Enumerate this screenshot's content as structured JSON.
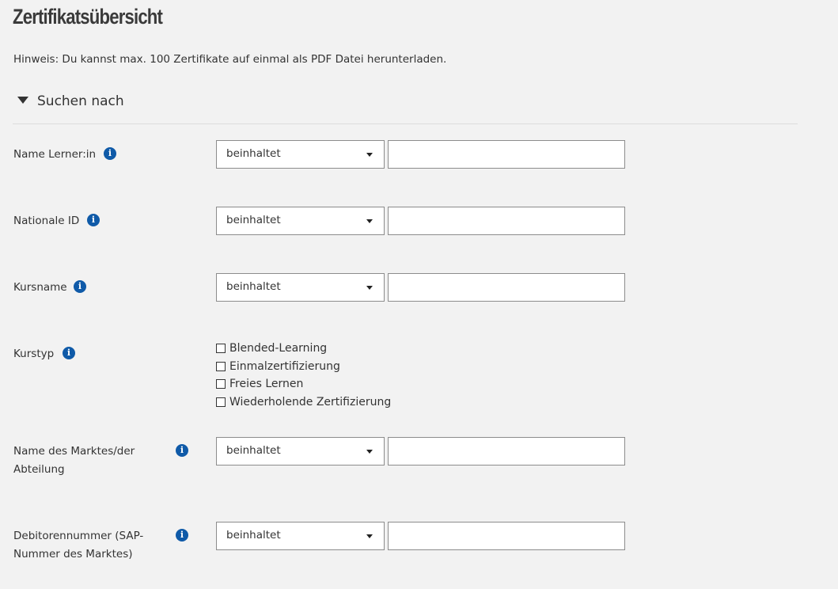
{
  "page": {
    "title": "Zertifikatsübersicht",
    "hint": "Hinweis: Du kannst max. 100 Zertifikate auf einmal als PDF Datei herunterladen."
  },
  "search": {
    "toggle_label": "Suchen nach",
    "info_icon_glyph": "i",
    "fields": {
      "learner_name": {
        "label": "Name Lerner:in",
        "operator": "beinhaltet",
        "value": ""
      },
      "national_id": {
        "label": "Nationale ID",
        "operator": "beinhaltet",
        "value": ""
      },
      "course_name": {
        "label": "Kursname",
        "operator": "beinhaltet",
        "value": ""
      },
      "course_type": {
        "label": "Kurstyp",
        "options": [
          {
            "label": "Blended-Learning",
            "checked": false
          },
          {
            "label": "Einmalzertifizierung",
            "checked": false
          },
          {
            "label": "Freies Lernen",
            "checked": false
          },
          {
            "label": "Wiederholende Zertifizierung",
            "checked": false
          }
        ]
      },
      "market_name": {
        "label_line1": "Name des Marktes/der",
        "label_line2": "Abteilung",
        "operator": "beinhaltet",
        "value": ""
      },
      "debtor_number": {
        "label_line1": "Debitorennummer (SAP-",
        "label_line2": "Nummer des Marktes)",
        "operator": "beinhaltet",
        "value": ""
      }
    }
  },
  "colors": {
    "background": "#f2f2f2",
    "info_icon": "#0f5aa8",
    "text": "#333333",
    "input_border": "#8c8c8c"
  }
}
